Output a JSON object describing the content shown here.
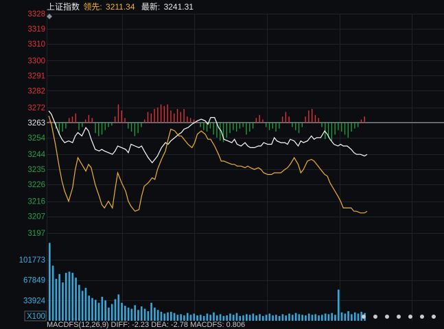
{
  "header": {
    "index_name": "上证指数",
    "leader_label": "领先:",
    "leader_value": "3211.34",
    "latest_label": "最新:",
    "latest_value": "3241.31"
  },
  "colors": {
    "background": "#0b0d10",
    "grid": "#1f2329",
    "up": "#e0343a",
    "down": "#1f9e3f",
    "price_line": "#ffffff",
    "leader_line": "#f2b233",
    "volume_bar": "#3aa7d6",
    "axis_up": "#e0343a",
    "axis_down": "#2aa14a",
    "axis_volume": "#3fb3e8",
    "baseline": "#7a7f86"
  },
  "indicator_row": {
    "text": "MACDFS(12,26,9) DIFF: -2.23  DEA: -2.78  MACDFS: 0.806"
  },
  "chart_data": {
    "type": "line",
    "title": "上证指数",
    "price_axis": {
      "reference": 3263,
      "ticks_up": [
        "3328",
        "3319",
        "3310",
        "3300",
        "3291",
        "3282",
        "3272"
      ],
      "tick_ref": "3263",
      "ticks_down": [
        "3254",
        "3244",
        "3235",
        "3226",
        "3216",
        "3207",
        "3197"
      ],
      "ylim": [
        3197,
        3328
      ]
    },
    "volume_axis": {
      "ticks": [
        "101773",
        "67849",
        "33924"
      ],
      "unit_label": "X100",
      "ylim": [
        0,
        135000
      ]
    },
    "x": [
      0,
      2,
      5,
      8,
      10,
      12,
      15,
      18,
      20,
      22,
      25,
      28,
      30,
      32,
      35,
      38,
      40,
      42,
      45,
      48,
      50,
      52,
      55,
      58,
      60,
      62,
      65,
      68,
      70,
      72,
      75,
      78,
      80,
      82,
      85,
      88,
      90,
      92,
      95,
      98,
      100,
      102,
      105,
      108,
      110,
      112,
      115,
      118,
      120,
      122,
      125,
      128,
      130,
      132,
      135,
      138,
      140,
      142,
      145,
      148,
      150,
      152,
      155,
      158,
      160,
      162,
      165,
      168,
      170,
      172,
      175,
      178,
      180,
      182,
      185,
      188,
      190,
      192,
      195,
      198,
      200,
      202,
      205,
      208,
      210,
      212,
      215,
      218,
      220,
      222,
      225,
      228,
      230,
      232,
      235,
      238,
      240
    ],
    "series": [
      {
        "role": "price",
        "values": [
          3270,
          3268,
          3262,
          3256,
          3253,
          3251,
          3252,
          3251,
          3255,
          3257,
          3255,
          3260,
          3258,
          3253,
          3247,
          3246,
          3247,
          3246,
          3245,
          3244,
          3246,
          3249,
          3248,
          3247,
          3245,
          3250,
          3249,
          3248,
          3249,
          3246,
          3242,
          3239,
          3241,
          3243,
          3248,
          3251,
          3250,
          3252,
          3254,
          3256,
          3257,
          3259,
          3260,
          3262,
          3263,
          3264,
          3265,
          3264,
          3262,
          3266,
          3266,
          3260,
          3258,
          3253,
          3252,
          3251,
          3253,
          3250,
          3249,
          3251,
          3249,
          3248,
          3248,
          3249,
          3249,
          3251,
          3250,
          3250,
          3254,
          3252,
          3251,
          3251,
          3250,
          3253,
          3252,
          3249,
          3252,
          3251,
          3252,
          3255,
          3253,
          3254,
          3254,
          3258,
          3256,
          3253,
          3250,
          3249,
          3250,
          3249,
          3249,
          3247,
          3245,
          3244,
          3244,
          3243,
          3244
        ]
      },
      {
        "role": "leader",
        "values": [
          3267,
          3262,
          3250,
          3236,
          3228,
          3222,
          3216,
          3224,
          3235,
          3242,
          3238,
          3234,
          3238,
          3236,
          3226,
          3219,
          3214,
          3212,
          3216,
          3212,
          3223,
          3233,
          3227,
          3222,
          3216,
          3213,
          3210,
          3211,
          3219,
          3225,
          3227,
          3230,
          3229,
          3235,
          3241,
          3246,
          3253,
          3259,
          3258,
          3255,
          3255,
          3253,
          3250,
          3248,
          3251,
          3256,
          3258,
          3256,
          3253,
          3253,
          3249,
          3244,
          3240,
          3240,
          3239,
          3238,
          3238,
          3237,
          3237,
          3236,
          3237,
          3236,
          3235,
          3236,
          3235,
          3233,
          3232,
          3232,
          3233,
          3233,
          3233,
          3235,
          3236,
          3238,
          3242,
          3238,
          3233,
          3235,
          3240,
          3241,
          3240,
          3238,
          3235,
          3232,
          3231,
          3227,
          3223,
          3219,
          3216,
          3212,
          3212,
          3212,
          3210,
          3210,
          3209,
          3209,
          3210
        ]
      }
    ],
    "up_down_bars": [
      0.1,
      0.05,
      -0.4,
      -0.8,
      -0.6,
      -0.4,
      0.3,
      0.4,
      0.6,
      -0.5,
      -0.3,
      0.2,
      0.5,
      0.3,
      -0.7,
      -0.9,
      -0.8,
      -0.5,
      -0.3,
      -0.2,
      0.4,
      1.2,
      0.8,
      0.3,
      -0.4,
      -0.6,
      -0.9,
      -0.7,
      -0.3,
      0.2,
      0.7,
      0.6,
      0.9,
      1.0,
      1.2,
      1.1,
      1.2,
      0.8,
      0.6,
      0.9,
      0.7,
      0.9,
      0.4,
      0.3,
      0.2,
      0.1,
      -0.3,
      -0.5,
      -0.6,
      -0.4,
      -0.8,
      -1.0,
      -1.2,
      -1.3,
      -1.0,
      -0.7,
      -0.5,
      -0.6,
      -0.4,
      -0.3,
      -0.8,
      -0.6,
      -0.4,
      0.3,
      0.5,
      0.2,
      -0.3,
      -0.5,
      -0.4,
      -0.6,
      -0.4,
      0.4,
      0.7,
      0.4,
      -0.3,
      -0.5,
      -0.7,
      -0.3,
      0.4,
      0.8,
      0.9,
      0.5,
      0.3,
      -0.3,
      -1.1,
      -1.0,
      -1.2,
      -0.8,
      -0.5,
      -0.6,
      -0.8,
      -1.0,
      -0.6,
      -0.4,
      -0.3,
      0.2,
      0.4
    ],
    "volume": [
      130000,
      92000,
      70000,
      78000,
      64000,
      80000,
      82000,
      80000,
      72000,
      60000,
      50000,
      55000,
      42000,
      38000,
      35000,
      30000,
      40000,
      34000,
      22000,
      28000,
      36000,
      44000,
      30000,
      25000,
      22000,
      20000,
      26000,
      18000,
      24000,
      20000,
      16000,
      30000,
      22000,
      18000,
      15000,
      12000,
      14000,
      15000,
      13000,
      10000,
      11000,
      9000,
      13000,
      10000,
      12000,
      9000,
      10000,
      8000,
      12000,
      10000,
      14000,
      9000,
      11000,
      8000,
      9000,
      12000,
      10000,
      13000,
      8000,
      9000,
      11000,
      10000,
      12000,
      9000,
      11000,
      8000,
      10000,
      12000,
      9000,
      10000,
      8000,
      11000,
      9000,
      12000,
      10000,
      13000,
      11000,
      10000,
      9000,
      12000,
      10000,
      11000,
      9000,
      10000,
      12000,
      11000,
      13000,
      10000,
      52000,
      14000,
      12000,
      16000,
      11000,
      14000,
      12000,
      15000,
      13000
    ]
  }
}
